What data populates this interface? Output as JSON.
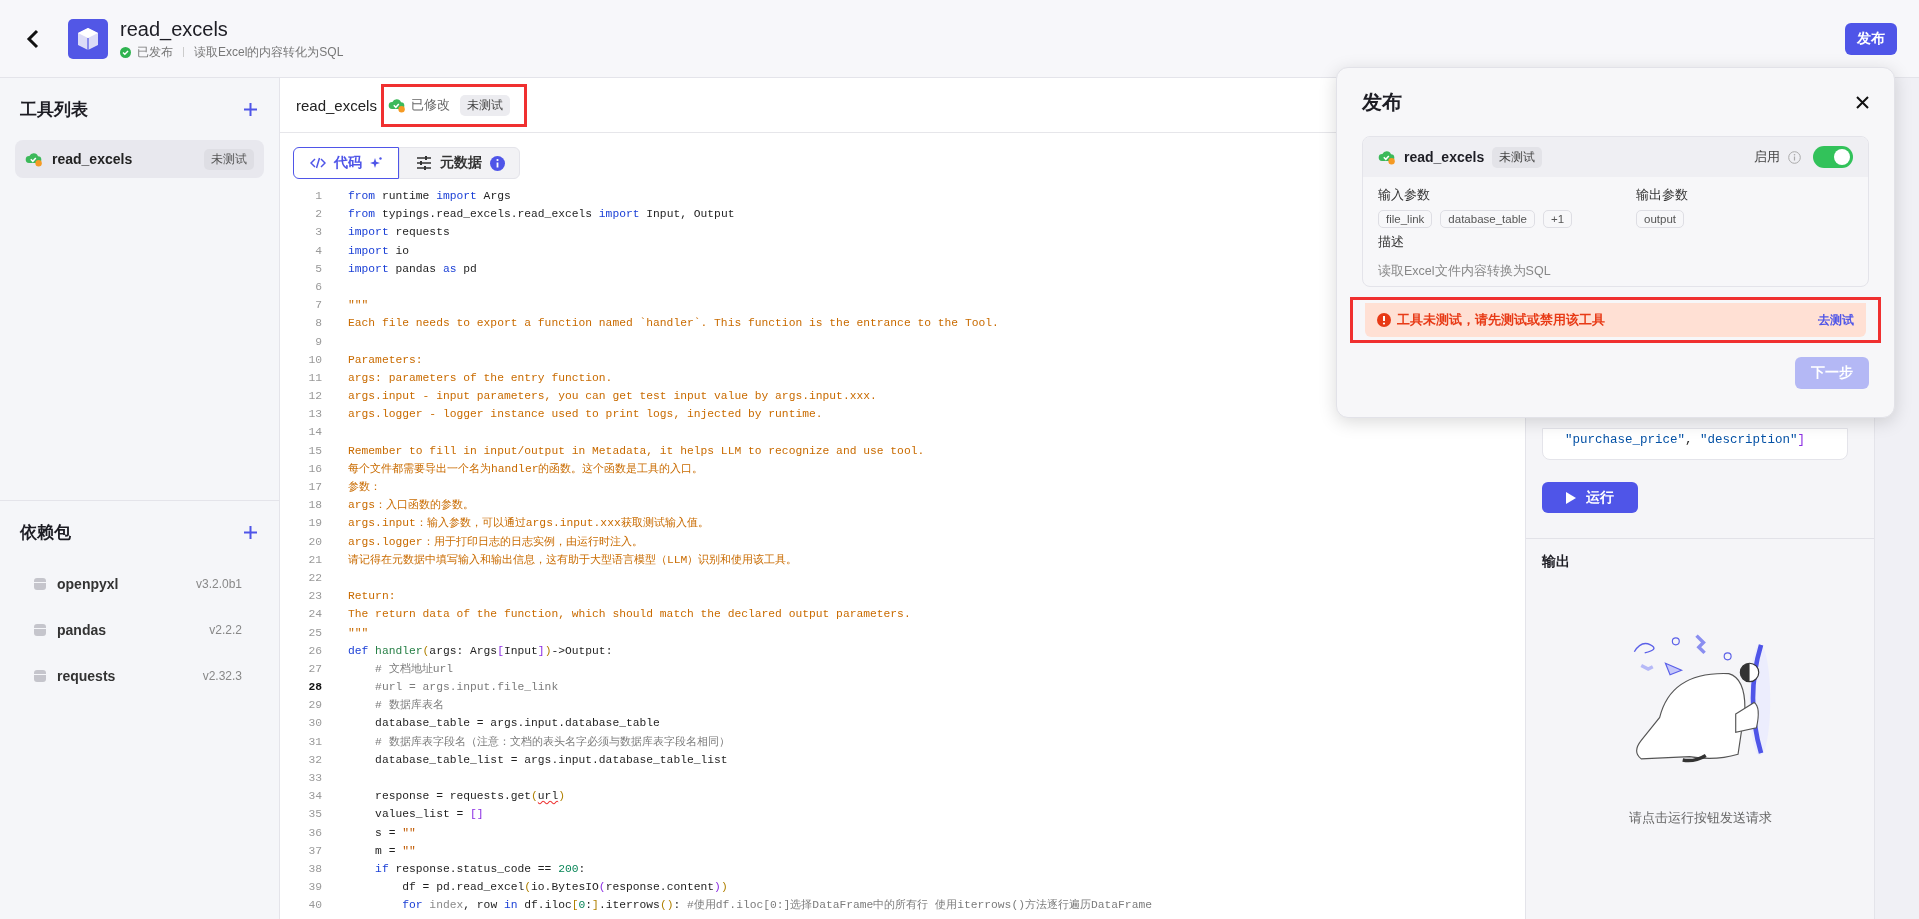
{
  "header": {
    "title": "read_excels",
    "status": "已发布",
    "description": "读取Excel的内容转化为SQL",
    "publish_button": "发布"
  },
  "sidebar": {
    "tools_title": "工具列表",
    "tools": [
      {
        "name": "read_excels",
        "badge": "未测试",
        "selected": true
      }
    ],
    "deps_title": "依赖包",
    "dependencies": [
      {
        "name": "openpyxl",
        "version": "v3.2.0b1"
      },
      {
        "name": "pandas",
        "version": "v2.2.2"
      },
      {
        "name": "requests",
        "version": "v2.32.3"
      }
    ]
  },
  "editor": {
    "file_name": "read_excels",
    "status": "已修改",
    "badge": "未测试",
    "highlighted": true,
    "tabs": [
      {
        "label": "代码",
        "selected": true
      },
      {
        "label": "元数据",
        "selected": false
      }
    ],
    "lines": [
      {
        "num": "1",
        "current": false,
        "tokens": [
          {
            "kind": "kw",
            "text": "from"
          },
          {
            "kind": "tx",
            "text": " runtime "
          },
          {
            "kind": "kw",
            "text": "import"
          },
          {
            "kind": "tx",
            "text": " Args"
          }
        ]
      },
      {
        "num": "2",
        "current": false,
        "tokens": [
          {
            "kind": "kw",
            "text": "from"
          },
          {
            "kind": "tx",
            "text": " typings.read_excels.read_excels "
          },
          {
            "kind": "kw",
            "text": "import"
          },
          {
            "kind": "tx",
            "text": " Input, Output"
          }
        ]
      },
      {
        "num": "3",
        "current": false,
        "tokens": [
          {
            "kind": "kw",
            "text": "import"
          },
          {
            "kind": "tx",
            "text": " requests"
          }
        ]
      },
      {
        "num": "4",
        "current": false,
        "tokens": [
          {
            "kind": "kw",
            "text": "import"
          },
          {
            "kind": "tx",
            "text": " io"
          }
        ]
      },
      {
        "num": "5",
        "current": false,
        "tokens": [
          {
            "kind": "kw",
            "text": "import"
          },
          {
            "kind": "tx",
            "text": " pandas "
          },
          {
            "kind": "kw",
            "text": "as"
          },
          {
            "kind": "tx",
            "text": " pd"
          }
        ]
      },
      {
        "num": "6",
        "current": false
      },
      {
        "num": "7",
        "current": false,
        "tokens": [
          {
            "kind": "doc",
            "text": "\"\"\""
          }
        ]
      },
      {
        "num": "8",
        "current": false,
        "tokens": [
          {
            "kind": "doc",
            "text": "Each file needs to export a function named `handler`. This function is the entrance to the Tool."
          }
        ]
      },
      {
        "num": "9",
        "current": false
      },
      {
        "num": "10",
        "current": false,
        "tokens": [
          {
            "kind": "doc",
            "text": "Parameters:"
          }
        ]
      },
      {
        "num": "11",
        "current": false,
        "tokens": [
          {
            "kind": "doc",
            "text": "args: parameters of the entry function."
          }
        ]
      },
      {
        "num": "12",
        "current": false,
        "tokens": [
          {
            "kind": "doc",
            "text": "args.input - input parameters, you can get test input value by args.input.xxx."
          }
        ]
      },
      {
        "num": "13",
        "current": false,
        "tokens": [
          {
            "kind": "doc",
            "text": "args.logger - logger instance used to print logs, injected by runtime."
          }
        ]
      },
      {
        "num": "14",
        "current": false
      },
      {
        "num": "15",
        "current": false,
        "tokens": [
          {
            "kind": "doc",
            "text": "Remember to fill in input/output in Metadata, it helps LLM to recognize and use tool."
          }
        ]
      },
      {
        "num": "16",
        "current": false,
        "tokens": [
          {
            "kind": "doc",
            "text": "每个文件都需要导出一个名为handler的函数。这个函数是工具的入口。"
          }
        ]
      },
      {
        "num": "17",
        "current": false,
        "tokens": [
          {
            "kind": "doc",
            "text": "参数："
          }
        ]
      },
      {
        "num": "18",
        "current": false,
        "tokens": [
          {
            "kind": "doc",
            "text": "args：入口函数的参数。"
          }
        ]
      },
      {
        "num": "19",
        "current": false,
        "tokens": [
          {
            "kind": "doc",
            "text": "args.input：输入参数，可以通过args.input.xxx获取测试输入值。"
          }
        ]
      },
      {
        "num": "20",
        "current": false,
        "tokens": [
          {
            "kind": "doc",
            "text": "args.logger：用于打印日志的日志实例，由运行时注入。"
          }
        ]
      },
      {
        "num": "21",
        "current": false,
        "tokens": [
          {
            "kind": "doc",
            "text": "请记得在元数据中填写输入和输出信息，这有助于大型语言模型（LLM）识别和使用该工具。"
          }
        ]
      },
      {
        "num": "22",
        "current": false
      },
      {
        "num": "23",
        "current": false,
        "tokens": [
          {
            "kind": "doc",
            "text": "Return:"
          }
        ]
      },
      {
        "num": "24",
        "current": false,
        "tokens": [
          {
            "kind": "doc",
            "text": "The return data of the function, which should match the declared output parameters."
          }
        ]
      },
      {
        "num": "25",
        "current": false,
        "tokens": [
          {
            "kind": "doc",
            "text": "\"\"\""
          }
        ]
      },
      {
        "num": "26",
        "current": false,
        "tokens": [
          {
            "kind": "kw",
            "text": "def"
          },
          {
            "kind": "fn",
            "text": " handler"
          },
          {
            "kind": "br",
            "text": "("
          },
          {
            "kind": "tx",
            "text": "args: Args"
          },
          {
            "kind": "br2",
            "text": "["
          },
          {
            "kind": "tx",
            "text": "Input"
          },
          {
            "kind": "br2",
            "text": "]"
          },
          {
            "kind": "br",
            "text": ")"
          },
          {
            "kind": "tx",
            "text": "->Output:"
          }
        ]
      },
      {
        "num": "27",
        "current": false,
        "tokens": [
          {
            "kind": "cm",
            "text": "    # 文档地址url"
          }
        ]
      },
      {
        "num": "28",
        "current": true,
        "tokens": [
          {
            "kind": "cm",
            "text": "    #url = args.input.file_link"
          }
        ]
      },
      {
        "num": "29",
        "current": false,
        "tokens": [
          {
            "kind": "cm",
            "text": "    # 数据库表名"
          }
        ]
      },
      {
        "num": "30",
        "current": false,
        "tokens": [
          {
            "kind": "tx",
            "text": "    database_table = args.input.database_table"
          }
        ]
      },
      {
        "num": "31",
        "current": false,
        "tokens": [
          {
            "kind": "cm",
            "text": "    # 数据库表字段名（注意：文档的表头名字必须与数据库表字段名相同）"
          }
        ]
      },
      {
        "num": "32",
        "current": false,
        "tokens": [
          {
            "kind": "tx",
            "text": "    database_table_list = args.input.database_table_list"
          }
        ]
      },
      {
        "num": "33",
        "current": false
      },
      {
        "num": "34",
        "current": false,
        "tokens": [
          {
            "kind": "tx",
            "text": "    response = requests.get"
          },
          {
            "kind": "br",
            "text": "("
          },
          {
            "kind": "err",
            "text": "url"
          },
          {
            "kind": "br",
            "text": ")"
          }
        ]
      },
      {
        "num": "35",
        "current": false,
        "tokens": [
          {
            "kind": "tx",
            "text": "    values_list = "
          },
          {
            "kind": "br2",
            "text": "[]"
          }
        ]
      },
      {
        "num": "36",
        "current": false,
        "tokens": [
          {
            "kind": "tx",
            "text": "    s = "
          },
          {
            "kind": "str",
            "text": "\"\""
          }
        ]
      },
      {
        "num": "37",
        "current": false,
        "tokens": [
          {
            "kind": "tx",
            "text": "    m = "
          },
          {
            "kind": "str",
            "text": "\"\""
          }
        ]
      },
      {
        "num": "38",
        "current": false,
        "tokens": [
          {
            "kind": "kw",
            "text": "    if"
          },
          {
            "kind": "tx",
            "text": " response.status_code == "
          },
          {
            "kind": "num",
            "text": "200"
          },
          {
            "kind": "tx",
            "text": ":"
          }
        ]
      },
      {
        "num": "39",
        "current": false,
        "tokens": [
          {
            "kind": "tx",
            "text": "        df = pd.read_excel"
          },
          {
            "kind": "br",
            "text": "("
          },
          {
            "kind": "tx",
            "text": "io.BytesIO"
          },
          {
            "kind": "br2",
            "text": "("
          },
          {
            "kind": "tx",
            "text": "response.content"
          },
          {
            "kind": "br2",
            "text": ")"
          },
          {
            "kind": "br",
            "text": ")"
          }
        ]
      },
      {
        "num": "40",
        "current": false,
        "tokens": [
          {
            "kind": "kw",
            "text": "        for"
          },
          {
            "kind": "dim",
            "text": " index"
          },
          {
            "kind": "tx",
            "text": ", row "
          },
          {
            "kind": "kw",
            "text": "in"
          },
          {
            "kind": "tx",
            "text": " df.iloc"
          },
          {
            "kind": "br",
            "text": "["
          },
          {
            "kind": "num",
            "text": "0"
          },
          {
            "kind": "tx",
            "text": ":"
          },
          {
            "kind": "br",
            "text": "]"
          },
          {
            "kind": "tx",
            "text": ".iterrows"
          },
          {
            "kind": "br",
            "text": "()"
          },
          {
            "kind": "tx",
            "text": ": "
          },
          {
            "kind": "cm",
            "text": "#使用df.iloc[0:]选择DataFrame中的所有行 使用iterrows()方法逐行遍历DataFrame"
          }
        ]
      }
    ]
  },
  "debug_panel": {
    "input_lines": [
      [
        {
          "kind": "str2",
          "text": "\"purchase_price\""
        },
        {
          "kind": "tx",
          "text": ", "
        },
        {
          "kind": "str2",
          "text": "\"description\""
        },
        {
          "kind": "br2",
          "text": "]"
        }
      ]
    ],
    "run_button": "运行",
    "output_title": "输出",
    "empty_text": "请点击运行按钮发送请求"
  },
  "dialog": {
    "title": "发布",
    "tool": {
      "name": "read_excels",
      "badge": "未测试",
      "enable_label": "启用",
      "enabled": true
    },
    "inputs_label": "输入参数",
    "inputs": [
      "file_link",
      "database_table",
      "+1"
    ],
    "outputs_label": "输出参数",
    "outputs": [
      "output"
    ],
    "description_label": "描述",
    "description": "读取Excel文件内容转换为SQL",
    "warning": {
      "text": "工具未测试，请先测试或禁用该工具",
      "action": "去测试",
      "highlighted": true
    },
    "next_button": {
      "label": "下一步",
      "disabled": true
    }
  }
}
